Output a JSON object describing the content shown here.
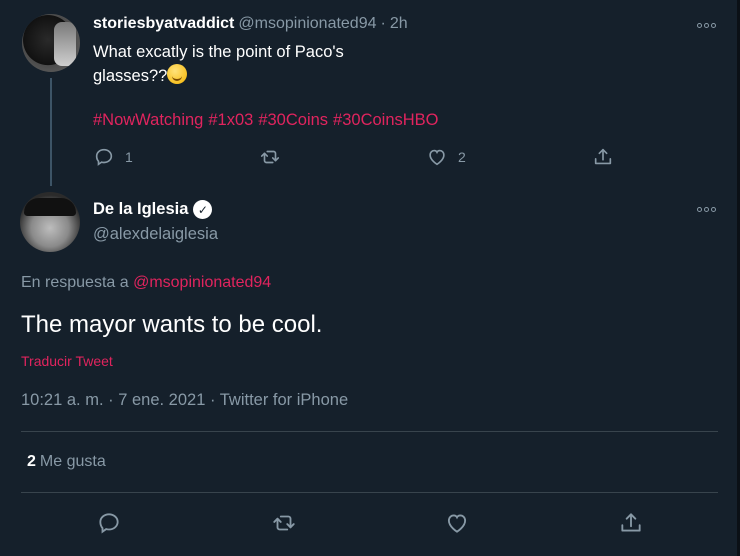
{
  "parent_tweet": {
    "display_name": "storiesbyatvaddict",
    "handle": "@msopinionated94",
    "separator": "·",
    "time": "2h",
    "text": "What excatly is the point of Paco's glasses??",
    "hashtags": [
      "#NowWatching",
      "#1x03",
      "#30Coins",
      "#30CoinsHBO"
    ],
    "reply_count": "1",
    "like_count": "2"
  },
  "focused_tweet": {
    "display_name": "De la Iglesia",
    "verified_mark": "✓",
    "handle": "@alexdelaiglesia",
    "reply_prefix": "En respuesta a",
    "reply_mention": "@msopinionated94",
    "text": "The mayor wants to be cool.",
    "translate_label": "Traducir Tweet",
    "meta": "10:21 a. m. · 7 ene. 2021 · Twitter for iPhone",
    "likes_count": "2",
    "likes_label": "Me gusta"
  },
  "colors": {
    "background": "#15202b",
    "accent": "#e0245e",
    "secondary_text": "#8899a6",
    "divider": "#38444d"
  },
  "icons": {
    "reply": "reply-icon",
    "retweet": "retweet-icon",
    "like": "heart-icon",
    "share": "share-icon",
    "more": "more-icon",
    "verified": "verified-badge-icon"
  }
}
